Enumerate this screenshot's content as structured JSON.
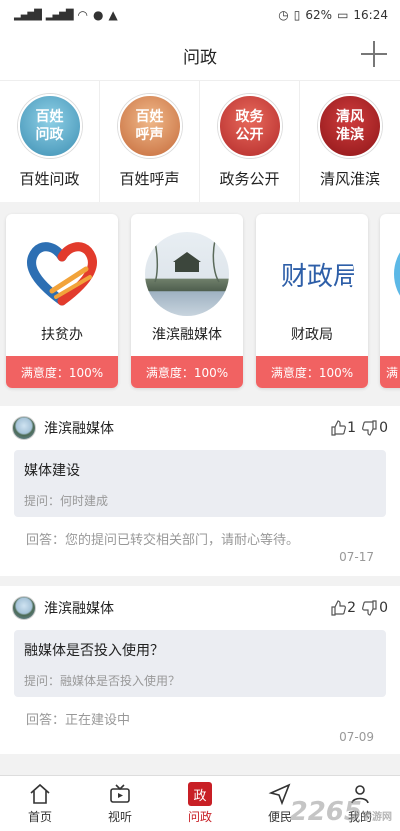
{
  "status": {
    "signal1": "4G",
    "signal2": "4G",
    "battery": "62%",
    "time": "16:24"
  },
  "header": {
    "title": "问政"
  },
  "categories": [
    {
      "label": "百姓问政",
      "icon_text": "百姓问政",
      "color": "#5aa9c9"
    },
    {
      "label": "百姓呼声",
      "icon_text": "百姓呼声",
      "color": "#d98f5b"
    },
    {
      "label": "政务公开",
      "icon_text": "政务公开",
      "color": "#c9393a"
    },
    {
      "label": "清风淮滨",
      "icon_text": "清风淮滨",
      "color": "#b51f22"
    }
  ],
  "departments": [
    {
      "name": "扶贫办",
      "satisfaction": "满意度：100%"
    },
    {
      "name": "淮滨融媒体",
      "satisfaction": "满意度：100%"
    },
    {
      "name": "财政局",
      "satisfaction": "满意度：100%",
      "logo_text": "财政局"
    },
    {
      "name": "",
      "satisfaction": "满"
    }
  ],
  "questions": [
    {
      "author": "淮滨融媒体",
      "likes": "1",
      "dislikes": "0",
      "title": "媒体建设",
      "question": "提问：何时建成",
      "answer": "回答：您的提问已转交相关部门，请耐心等待。",
      "date": "07-17"
    },
    {
      "author": "淮滨融媒体",
      "likes": "2",
      "dislikes": "0",
      "title": "融媒体是否投入使用？",
      "question": "提问：融媒体是否投入使用？",
      "answer": "回答：正在建设中",
      "date": "07-09"
    }
  ],
  "tabs": [
    "首页",
    "视听",
    "问政",
    "便民",
    "我的"
  ],
  "watermark": {
    "text": "2265",
    "sub": "手游网"
  },
  "colors": {
    "accent": "#c81f25",
    "satisfaction_bar": "#f16262"
  }
}
